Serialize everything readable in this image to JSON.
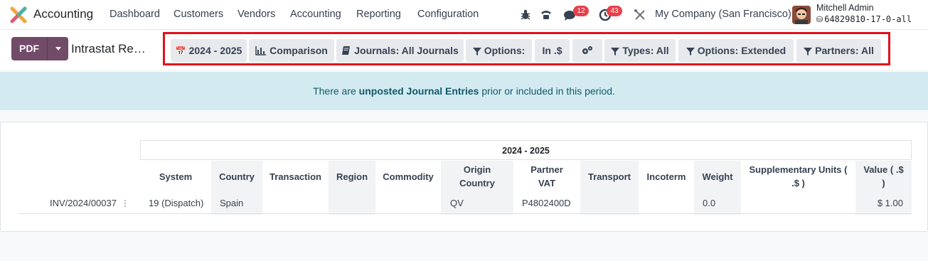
{
  "app": {
    "title": "Accounting"
  },
  "nav": {
    "items": [
      "Dashboard",
      "Customers",
      "Vendors",
      "Accounting",
      "Reporting",
      "Configuration"
    ]
  },
  "systray": {
    "messages_count": "12",
    "activities_count": "43",
    "company": "My Company (San Francisco)",
    "user_name": "Mitchell Admin",
    "db_name": "64829810-17-0-all"
  },
  "toolbar": {
    "pdf_label": "PDF",
    "report_title": "Intrastat Re…",
    "filters": {
      "date": "2024 - 2025",
      "comparison": "Comparison",
      "journals": "Journals: All Journals",
      "options": "Options:",
      "currency": "In .$",
      "types": "Types: All",
      "options_extended": "Options: Extended",
      "partners": "Partners: All"
    }
  },
  "alert": {
    "prefix": "There are ",
    "link": "unposted Journal Entries",
    "suffix": " prior or included in this period."
  },
  "report": {
    "period": "2024 - 2025",
    "columns": {
      "system": "System",
      "country": "Country",
      "transaction": "Transaction",
      "region": "Region",
      "commodity": "Commodity",
      "origin_country_1": "Origin",
      "origin_country_2": "Country",
      "partner_vat_1": "Partner",
      "partner_vat_2": "VAT",
      "transport": "Transport",
      "incoterm": "Incoterm",
      "weight": "Weight",
      "supp_units_1": "Supplementary Units (",
      "supp_units_2": ".$ )",
      "value_1": "Value ( .$",
      "value_2": ")"
    },
    "row": {
      "name": "INV/2024/00037",
      "system": "19 (Dispatch)",
      "country": "Spain",
      "transaction": "",
      "region": "",
      "commodity": "",
      "origin_country": "QV",
      "partner_vat": "P4802400D",
      "transport": "",
      "incoterm": "",
      "weight": "0.0",
      "supp_units": "",
      "value": "$ 1.00"
    }
  },
  "colors": {
    "brand": "#714b67",
    "alert_bg": "#d3ebf0",
    "alert_text": "#13586b",
    "highlight_border": "#e3101c",
    "badge": "#e8404b"
  }
}
